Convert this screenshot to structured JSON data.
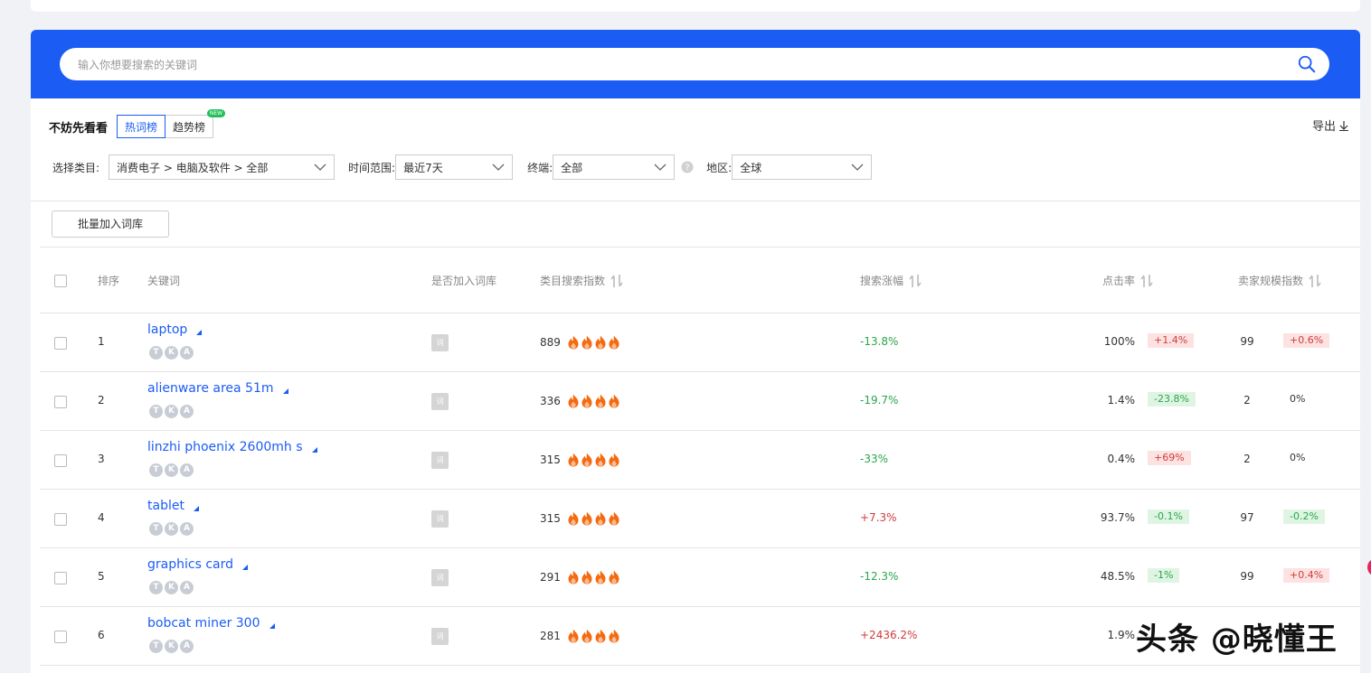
{
  "search": {
    "placeholder": "输入你想要搜索的关键词"
  },
  "board": {
    "label": "不妨先看看",
    "tabs": [
      {
        "label": "热词榜",
        "active": true
      },
      {
        "label": "趋势榜",
        "active": false,
        "badge": "NEW"
      }
    ],
    "export_label": "导出"
  },
  "filters": {
    "category_label": "选择类目:",
    "category_value": "消费电子 > 电脑及软件 > 全部",
    "time_label": "时间范围:",
    "time_value": "最近7天",
    "terminal_label": "终端:",
    "terminal_value": "全部",
    "region_label": "地区:",
    "region_value": "全球"
  },
  "batch_button": "批量加入词库",
  "table": {
    "headers": {
      "rank": "排序",
      "keyword": "关键词",
      "in_dict": "是否加入词库",
      "search_index": "类目搜索指数",
      "search_growth": "搜索涨幅",
      "ctr": "点击率",
      "seller_index": "卖家规模指数"
    },
    "dict_icon_label": "词",
    "badges": [
      "T",
      "K",
      "A"
    ],
    "rows": [
      {
        "rank": "1",
        "keyword": "laptop",
        "search_index": "889",
        "search_growth": "-13.8%",
        "ctr": "100%",
        "ctr_change": "+1.4%",
        "seller_index": "99",
        "seller_change": "+0.6%"
      },
      {
        "rank": "2",
        "keyword": "alienware area 51m",
        "search_index": "336",
        "search_growth": "-19.7%",
        "ctr": "1.4%",
        "ctr_change": "-23.8%",
        "seller_index": "2",
        "seller_change": "0%"
      },
      {
        "rank": "3",
        "keyword": "linzhi phoenix 2600mh s",
        "search_index": "315",
        "search_growth": "-33%",
        "ctr": "0.4%",
        "ctr_change": "+69%",
        "seller_index": "2",
        "seller_change": "0%"
      },
      {
        "rank": "4",
        "keyword": "tablet",
        "search_index": "315",
        "search_growth": "+7.3%",
        "ctr": "93.7%",
        "ctr_change": "-0.1%",
        "seller_index": "97",
        "seller_change": "-0.2%"
      },
      {
        "rank": "5",
        "keyword": "graphics card",
        "search_index": "291",
        "search_growth": "-12.3%",
        "ctr": "48.5%",
        "ctr_change": "-1%",
        "seller_index": "99",
        "seller_change": "+0.4%"
      },
      {
        "rank": "6",
        "keyword": "bobcat miner 300",
        "search_index": "281",
        "search_growth": "+2436.2%",
        "ctr": "1.9%",
        "ctr_change": "",
        "seller_index": "",
        "seller_change": ""
      }
    ]
  },
  "colors": {
    "brand": "#1b5cf5",
    "up": "#d13c3c",
    "down": "#2aa64a",
    "fire": "#f46a10"
  },
  "icons": [
    "search-icon",
    "download-icon",
    "chevron-down-icon",
    "help-icon",
    "sort-icon",
    "fire-icon",
    "triangle-icon"
  ],
  "watermark": "头条 @晓懂王"
}
